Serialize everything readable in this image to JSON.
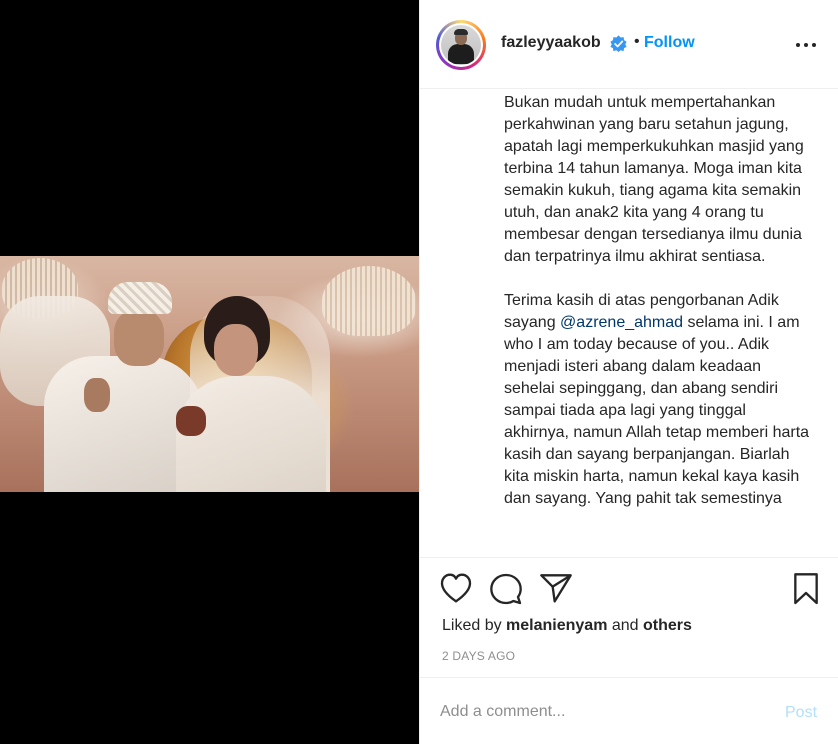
{
  "post": {
    "username": "fazleyyaakob",
    "follow_label": "Follow",
    "dot": "•",
    "caption_paragraphs": [
      "Bukan mudah untuk mempertahankan perkahwinan yang baru setahun jagung, apatah lagi memperkukuhkan masjid yang terbina 14 tahun lamanya. Moga iman kita semakin kukuh, tiang agama kita semakin utuh, dan anak2 kita yang 4 orang tu membesar dengan tersedianya ilmu dunia dan terpatrinya ilmu akhirat sentiasa."
    ],
    "caption_p2_before": "Terima kasih di atas pengorbanan Adik sayang ",
    "caption_p2_mention": "@azrene_ahmad",
    "caption_p2_after": " selama ini. I am who I am today because of you.. Adik menjadi isteri abang dalam keadaan sehelai sepinggang, dan abang sendiri sampai tiada apa lagi yang tinggal akhirnya, namun Allah tetap memberi harta kasih dan sayang berpanjangan. Biarlah kita miskin harta, namun kekal kaya kasih dan sayang. Yang pahit tak semestinya",
    "liked_by_prefix": "Liked by ",
    "liked_by_user": "melanienyam",
    "liked_by_and": " and ",
    "liked_by_others": "others",
    "timestamp": "2 DAYS AGO",
    "comment_placeholder": "Add a comment...",
    "post_label": "Post"
  },
  "icons": {
    "verified": "verified-badge-icon",
    "more": "more-options-icon",
    "like": "heart-icon",
    "comment": "comment-bubble-icon",
    "share": "paper-plane-icon",
    "save": "bookmark-icon"
  },
  "colors": {
    "accent": "#0095f6",
    "mention": "#00376b",
    "post_disabled": "#b2dffc",
    "muted": "#8e8e8e"
  }
}
